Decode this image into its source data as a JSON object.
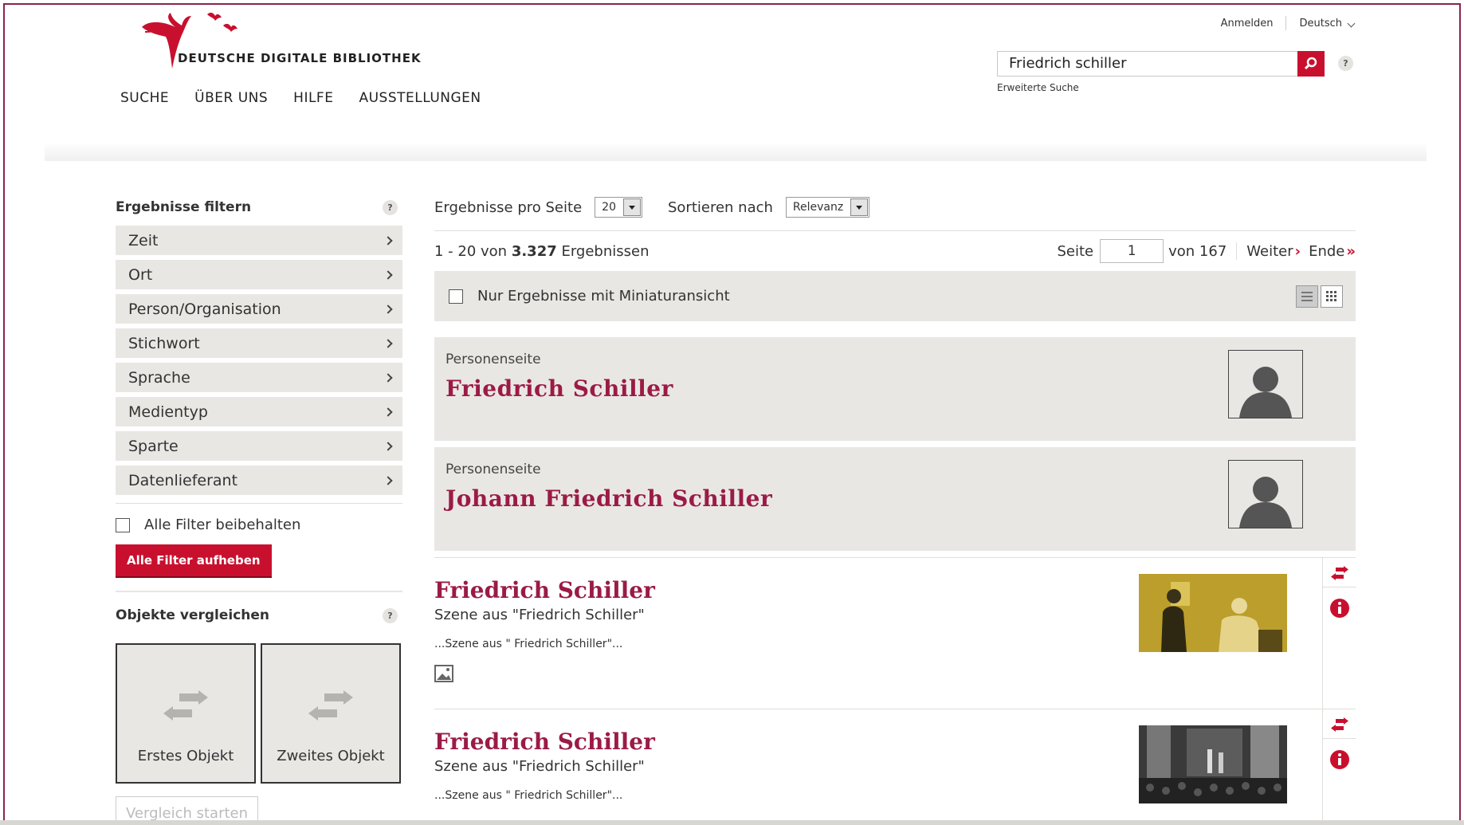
{
  "brand": {
    "name": "DEUTSCHE DIGITALE BIBLIOTHEK",
    "accent": "#c8102e",
    "title_color": "#9b1b46"
  },
  "top_links": {
    "login": "Anmelden",
    "language": "Deutsch"
  },
  "nav": [
    "SUCHE",
    "ÜBER UNS",
    "HILFE",
    "AUSSTELLUNGEN"
  ],
  "search": {
    "value": "Friedrich schiller",
    "advanced": "Erweiterte Suche",
    "help": "?"
  },
  "sidebar": {
    "filter_title": "Ergebnisse filtern",
    "filters": [
      "Zeit",
      "Ort",
      "Person/Organisation",
      "Stichwort",
      "Sprache",
      "Medientyp",
      "Sparte",
      "Datenlieferant"
    ],
    "keep_filters": "Alle Filter beibehalten",
    "clear_filters": "Alle Filter aufheben",
    "compare_title": "Objekte vergleichen",
    "compare_first": "Erstes Objekt",
    "compare_second": "Zweites Objekt",
    "compare_start": "Vergleich starten"
  },
  "results": {
    "per_page_label": "Ergebnisse pro Seite",
    "per_page_value": "20",
    "sort_label": "Sortieren nach",
    "sort_value": "Relevanz",
    "summary_prefix": "1 - 20 von ",
    "summary_count": "3.327",
    "summary_suffix": " Ergebnissen",
    "page_label": "Seite",
    "page_value": "1",
    "page_total": "von 167",
    "next": "Weiter",
    "end": "Ende",
    "thumb_only": "Nur Ergebnisse mit Miniaturansicht"
  },
  "persons": [
    {
      "kind": "Personenseite",
      "name": "Friedrich Schiller"
    },
    {
      "kind": "Personenseite",
      "name": "Johann Friedrich Schiller"
    }
  ],
  "hits": [
    {
      "title": "Friedrich Schiller",
      "subtitle": "Szene aus \"Friedrich Schiller\"",
      "snippet": "...Szene aus \" Friedrich Schiller\"..."
    },
    {
      "title": "Friedrich Schiller",
      "subtitle": "Szene aus \"Friedrich Schiller\"",
      "snippet": "...Szene aus \" Friedrich Schiller\"..."
    }
  ]
}
